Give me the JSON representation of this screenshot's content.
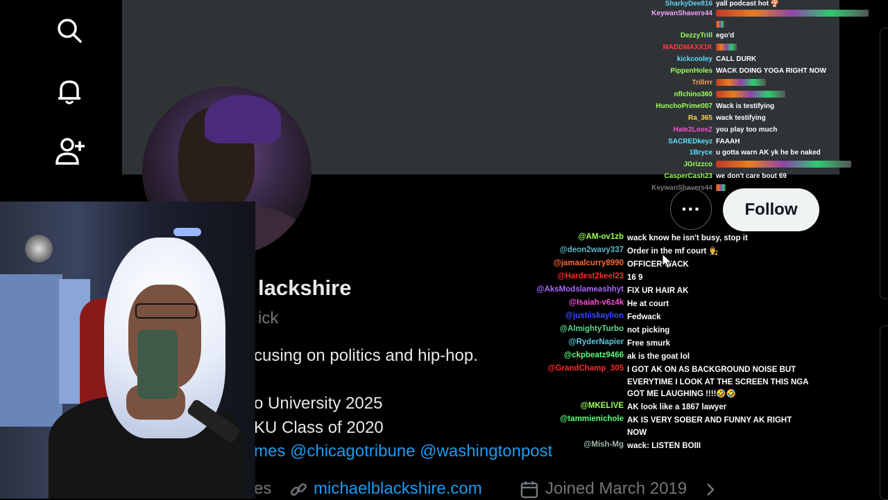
{
  "sidebar": {
    "icons": [
      "search-icon",
      "bell-icon",
      "add-user-icon"
    ]
  },
  "profile": {
    "name_partial": "lackshire",
    "handle_partial": "ick",
    "bio_partial": "cusing on politics and hip-hop.",
    "edu_1": "o University 2025",
    "edu_2": "KU Class of 2020",
    "bio_links_prefix": "mes ",
    "bio_link_1": "@chicagotribune",
    "bio_link_2": "@washingtonpost",
    "meta_partial": "es",
    "website": "michaelblackshire.com",
    "joined": "Joined March 2019",
    "more_label": "···",
    "follow_label": "Follow"
  },
  "colors": {
    "accent": "#1d9bf0",
    "follow_bg": "#eff3f4",
    "banner": "#2f3336"
  },
  "chat_top": [
    {
      "user": "SharkyDee816",
      "color": "#5fd3f5",
      "msg": "yall podcast hot 🍄"
    },
    {
      "user": "KeywanShavers44",
      "color": "#f5a3ff",
      "msg": "",
      "emote": true,
      "emote_w": 220
    },
    {
      "user": "",
      "color": "#fff",
      "msg": "",
      "emote": true,
      "emote_w": 12
    },
    {
      "user": "DezzyTrill",
      "color": "#9cff59",
      "msg": "ego'd"
    },
    {
      "user": "MADDMAXX1K",
      "color": "#ff3b3b",
      "msg": "",
      "emote": true,
      "emote_w": 30
    },
    {
      "user": "kickcooley",
      "color": "#59e1ff",
      "msg": "CALL DURK"
    },
    {
      "user": "PippenHoles",
      "color": "#9cff59",
      "msg": "WACK DOING YOGA RIGHT NOW"
    },
    {
      "user": "Trillrrr",
      "color": "#ff9f59",
      "msg": "",
      "emote": true,
      "emote_w": 72
    },
    {
      "user": "nflchino360",
      "color": "#9cff59",
      "msg": "",
      "emote": true,
      "emote_w": 100
    },
    {
      "user": "HunchoPrime007",
      "color": "#9cff59",
      "msg": "Wack is testifying"
    },
    {
      "user": "Ra_365",
      "color": "#ffd24d",
      "msg": "wack testifying"
    },
    {
      "user": "Hate2LoveZ",
      "color": "#ff4fd8",
      "msg": "you play too much"
    },
    {
      "user": "SACREDkeyz",
      "color": "#59e1ff",
      "msg": "FAAAH"
    },
    {
      "user": "1Bryce",
      "color": "#59e1ff",
      "msg": "u gotta warn AK yk he be naked"
    },
    {
      "user": "JGrizzco",
      "color": "#9cff59",
      "msg": "",
      "emote": true,
      "emote_w": 195
    },
    {
      "user": "CasperCash23",
      "color": "#9cff59",
      "msg": "we don't care bout 69"
    },
    {
      "user": "KeywanShavers44",
      "color": "#777",
      "msg": "",
      "emote": true,
      "emote_w": 14
    }
  ],
  "chat_bottom": [
    {
      "user": "@AM-ov1zb",
      "color": "#9cff59",
      "msg": "wack know he isn't busy, stop it"
    },
    {
      "user": "@deon2wavy337",
      "color": "#5fb8c9",
      "msg": "Order in the mf court 👨‍⚖️"
    },
    {
      "user": "@jamaalcurry8990",
      "color": "#ff6a3b",
      "msg": "OFFICER WACK"
    },
    {
      "user": "@Hardest2keel23",
      "color": "#ff2a2a",
      "msg": "16 9"
    },
    {
      "user": "@AksModslameashhyt",
      "color": "#a66bff",
      "msg": "FIX UR HAIR AK"
    },
    {
      "user": "@Isaiah-v6z4k",
      "color": "#ff4fd8",
      "msg": "He at court"
    },
    {
      "user": "@justiiskaylion",
      "color": "#3b4bff",
      "msg": "Fedwack"
    },
    {
      "user": "@AlmightyTurbo",
      "color": "#59d98c",
      "msg": "not picking"
    },
    {
      "user": "@RyderNapier",
      "color": "#59c9e1",
      "msg": "Free smurk"
    },
    {
      "user": "@ckpbeatz9466",
      "color": "#59ff7a",
      "msg": "ak is the goat lol"
    },
    {
      "user": "@GrandChamp_305",
      "color": "#ff2a2a",
      "msg": "I GOT AK ON AS BACKGROUND NOISE BUT",
      "msg2": "EVERYTIME I LOOK AT THE SCREEN THIS NGA",
      "msg3": "GOT ME LAUGHING !!!!🤣🤣"
    },
    {
      "user": "@MKELIVE",
      "color": "#9cff59",
      "msg": "AK look like a 1867 lawyer"
    },
    {
      "user": "@tammienichole",
      "color": "#59ff7a",
      "msg": "AK IS VERY SOBER AND FUNNY AK RIGHT",
      "msg2": "NOW"
    },
    {
      "user": "@Mish-Mg",
      "color": "#9cb8a8",
      "msg": "wack: LISTEN BOIII"
    }
  ]
}
